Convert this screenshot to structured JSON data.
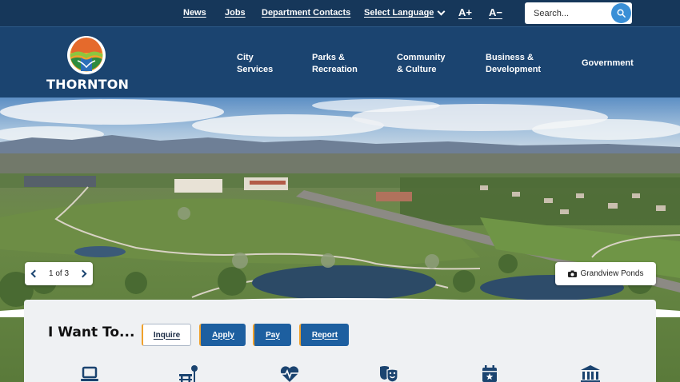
{
  "utility_bar": {
    "links": [
      "News",
      "Jobs",
      "Department Contacts"
    ],
    "language_label": "Select Language",
    "font_increase": "A+",
    "font_decrease": "A−",
    "search_placeholder": "Search..."
  },
  "header": {
    "logo_text": "THORNTON",
    "nav": [
      {
        "line1": "City",
        "line2": "Services"
      },
      {
        "line1": "Parks &",
        "line2": "Recreation"
      },
      {
        "line1": "Community",
        "line2": "& Culture"
      },
      {
        "line1": "Business &",
        "line2": "Development"
      },
      {
        "line1": "Government",
        "line2": ""
      }
    ]
  },
  "hero": {
    "slide_counter": "1 of 3",
    "caption": "Grandview Ponds",
    "caption_icon": "camera-icon"
  },
  "i_want_to": {
    "title": "I Want To...",
    "buttons": [
      "Inquire",
      "Apply",
      "Pay",
      "Report"
    ],
    "active_button": "Inquire",
    "quick_icons": [
      "laptop-icon",
      "picnic-table-icon",
      "heart-pulse-icon",
      "theater-masks-icon",
      "calendar-star-icon",
      "government-building-icon"
    ]
  },
  "colors": {
    "utility_bg": "#16375a",
    "header_bg": "#1b4470",
    "accent_orange": "#f0a12b",
    "button_blue": "#1d5fa0",
    "search_button": "#3a8fd6"
  }
}
